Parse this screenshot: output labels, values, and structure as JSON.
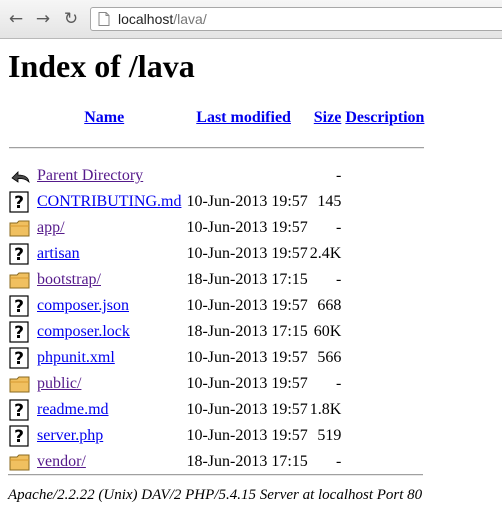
{
  "browser": {
    "url_host": "localhost",
    "url_path": "/lava/"
  },
  "page": {
    "title": "Index of /lava"
  },
  "table": {
    "headers": {
      "name": "Name",
      "last_modified": "Last modified",
      "size": "Size",
      "description": "Description"
    },
    "parent": {
      "name": "Parent Directory",
      "size": "-"
    },
    "rows": [
      {
        "icon": "file-unknown-icon",
        "name": "CONTRIBUTING.md",
        "modified": "10-Jun-2013 19:57",
        "size": "145"
      },
      {
        "icon": "folder-icon",
        "name": "app/",
        "modified": "10-Jun-2013 19:57",
        "size": "-"
      },
      {
        "icon": "file-unknown-icon",
        "name": "artisan",
        "modified": "10-Jun-2013 19:57",
        "size": "2.4K"
      },
      {
        "icon": "folder-icon",
        "name": "bootstrap/",
        "modified": "18-Jun-2013 17:15",
        "size": "-"
      },
      {
        "icon": "file-unknown-icon",
        "name": "composer.json",
        "modified": "10-Jun-2013 19:57",
        "size": "668"
      },
      {
        "icon": "file-unknown-icon",
        "name": "composer.lock",
        "modified": "18-Jun-2013 17:15",
        "size": "60K"
      },
      {
        "icon": "file-unknown-icon",
        "name": "phpunit.xml",
        "modified": "10-Jun-2013 19:57",
        "size": "566"
      },
      {
        "icon": "folder-icon",
        "name": "public/",
        "modified": "10-Jun-2013 19:57",
        "size": "-"
      },
      {
        "icon": "file-unknown-icon",
        "name": "readme.md",
        "modified": "10-Jun-2013 19:57",
        "size": "1.8K"
      },
      {
        "icon": "file-unknown-icon",
        "name": "server.php",
        "modified": "10-Jun-2013 19:57",
        "size": "519"
      },
      {
        "icon": "folder-icon",
        "name": "vendor/",
        "modified": "18-Jun-2013 17:15",
        "size": "-"
      }
    ]
  },
  "footer": {
    "address": "Apache/2.2.22 (Unix) DAV/2 PHP/5.4.15 Server at localhost Port 80"
  }
}
